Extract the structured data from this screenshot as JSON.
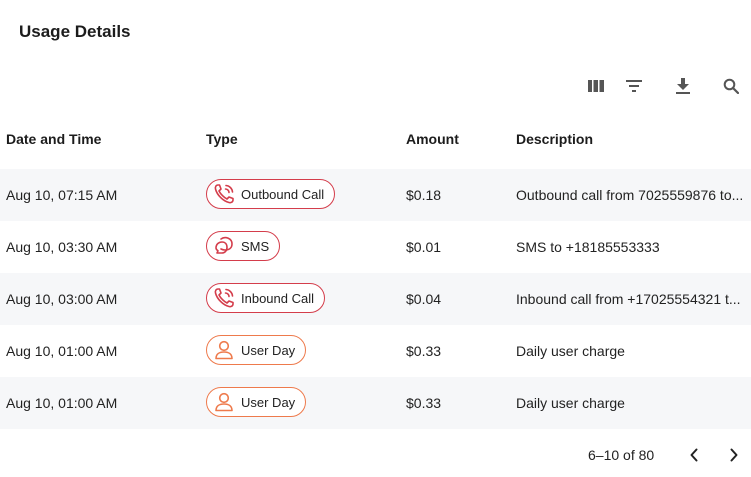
{
  "page": {
    "title": "Usage Details"
  },
  "toolbar": {
    "icons": [
      "columns-icon",
      "filter-icon",
      "download-icon",
      "search-icon"
    ]
  },
  "table": {
    "columns": [
      "Date and Time",
      "Type",
      "Amount",
      "Description"
    ],
    "rows": [
      {
        "date": "Aug 10, 07:15 AM",
        "type": "Outbound Call",
        "type_icon": "phone-outbound-icon",
        "amount": "$0.18",
        "description": "Outbound call from 7025559876 to..."
      },
      {
        "date": "Aug 10, 03:30 AM",
        "type": "SMS",
        "type_icon": "chat-bubble-icon",
        "amount": "$0.01",
        "description": "SMS to +18185553333"
      },
      {
        "date": "Aug 10, 03:00 AM",
        "type": "Inbound Call",
        "type_icon": "phone-inbound-icon",
        "amount": "$0.04",
        "description": "Inbound call from +17025554321 t..."
      },
      {
        "date": "Aug 10, 01:00 AM",
        "type": "User Day",
        "type_icon": "user-icon",
        "amount": "$0.33",
        "description": "Daily user charge"
      },
      {
        "date": "Aug 10, 01:00 AM",
        "type": "User Day",
        "type_icon": "user-icon",
        "amount": "$0.33",
        "description": "Daily user charge"
      }
    ]
  },
  "pagination": {
    "range": "6–10 of 80"
  },
  "colors": {
    "call_chip": "#d43d4b",
    "user_chip": "#ee7a4c",
    "row_alt": "#f6f7f9"
  }
}
